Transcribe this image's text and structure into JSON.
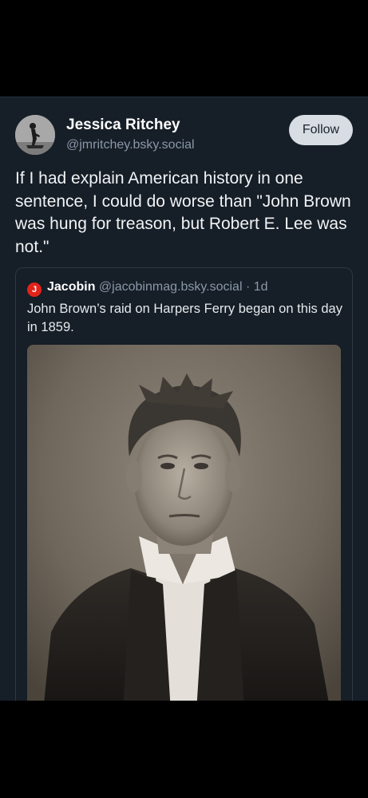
{
  "post": {
    "author": {
      "name": "Jessica Ritchey",
      "handle": "@jmritchey.bsky.social",
      "avatar_icon": "avatar-photo"
    },
    "follow_label": "Follow",
    "text": "If I had explain American history in one sentence, I could do worse than \"John Brown was hung for treason, but Robert E. Lee was not.\""
  },
  "quote": {
    "avatar_letter": "J",
    "name": "Jacobin",
    "handle": "@jacobinmag.bsky.social",
    "separator": "·",
    "time": "1d",
    "text": "John Brown’s raid on Harpers Ferry began on this day in 1859.",
    "image_icon": "john-brown-portrait-image"
  },
  "colors": {
    "background": "#000000",
    "card": "#161e27",
    "text": "#f1f3f5",
    "muted": "#8a98a8",
    "follow_button": "#d8dde3",
    "jacobin_red": "#e2231a"
  }
}
